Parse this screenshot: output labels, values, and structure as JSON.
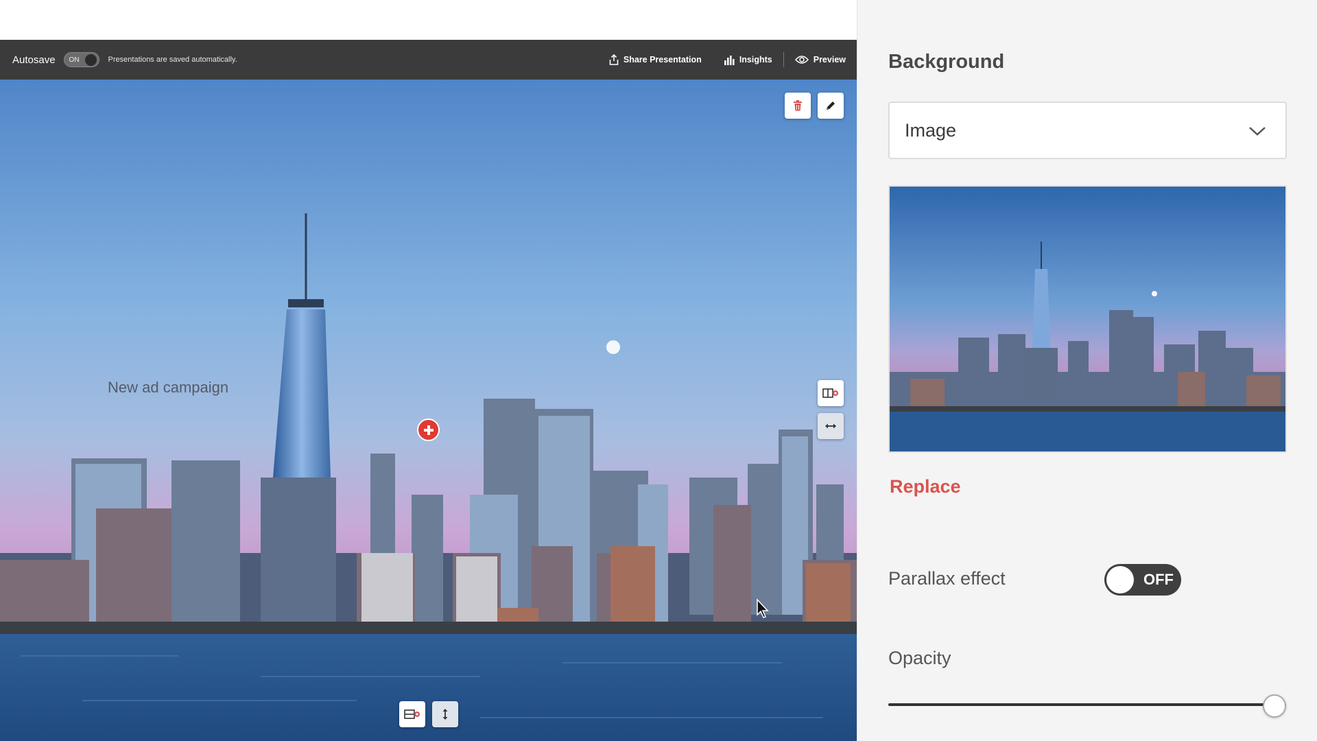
{
  "toolbar": {
    "autosave_label": "Autosave",
    "autosave_state": "ON",
    "autosave_note": "Presentations are saved automatically.",
    "share_label": "Share Presentation",
    "insights_label": "Insights",
    "preview_label": "Preview"
  },
  "canvas": {
    "slide_title": "New ad campaign",
    "icons": [
      "trash-icon",
      "pencil-icon",
      "add-section-icon",
      "resize-horizontal-icon",
      "resize-vertical-icon",
      "plus-icon",
      "mouse-cursor-icon"
    ]
  },
  "panel": {
    "title": "Background",
    "background_type": "Image",
    "replace_label": "Replace",
    "parallax_label": "Parallax effect",
    "parallax_state": "OFF",
    "opacity_label": "Opacity",
    "opacity_value": 1.0
  },
  "colors": {
    "toolbar_bg": "#3b3b3b",
    "accent_red": "#d9534f",
    "panel_bg": "#f4f4f4"
  }
}
